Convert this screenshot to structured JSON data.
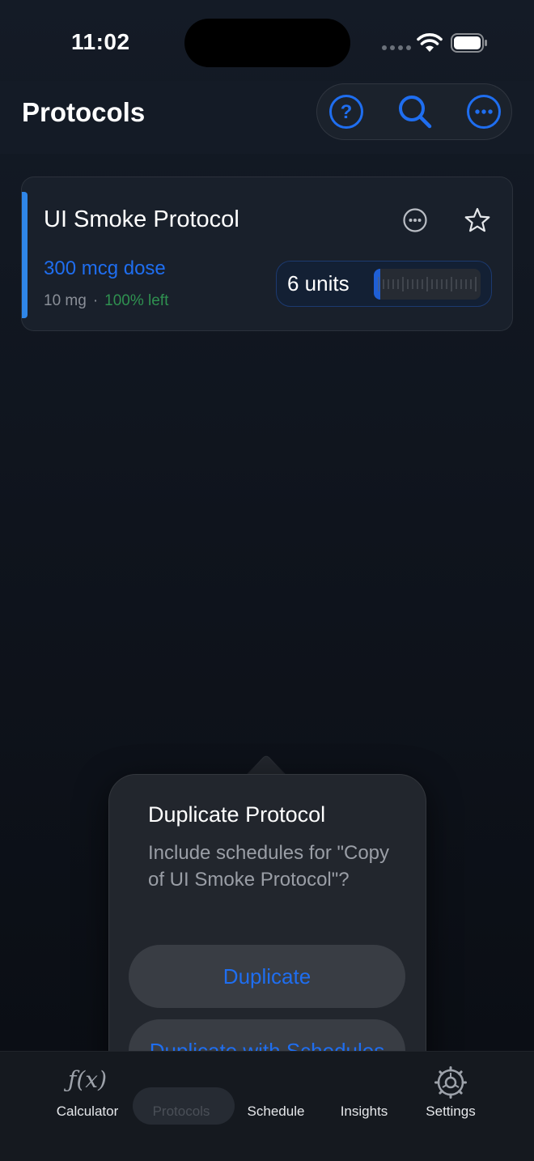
{
  "status_bar": {
    "time": "11:02"
  },
  "header": {
    "title": "Protocols",
    "actions": [
      "help-icon",
      "search-icon",
      "more-icon"
    ]
  },
  "protocol_card": {
    "name": "UI Smoke Protocol",
    "dose": "300 mcg dose",
    "amount": "10 mg",
    "separator": "·",
    "remaining": "100% left",
    "units": "6 units",
    "syringe_fill_fraction": 0.06,
    "accent_color": "#2f86e8"
  },
  "popover": {
    "title": "Duplicate Protocol",
    "message": "Include schedules for \"Copy of UI Smoke Protocol\"?",
    "buttons": {
      "duplicate": "Duplicate",
      "duplicate_with_schedules": "Duplicate with Schedules"
    }
  },
  "tab_bar": {
    "items": [
      {
        "label": "Calculator",
        "icon": "fx-icon"
      },
      {
        "label": "Protocols",
        "icon": "protocols-icon",
        "selected": true
      },
      {
        "label": "Schedule",
        "icon": "calendar-icon"
      },
      {
        "label": "Insights",
        "icon": "chart-icon"
      },
      {
        "label": "Settings",
        "icon": "gear-icon"
      }
    ]
  },
  "colors": {
    "accent": "#1f6ef0",
    "success": "#2f9150",
    "background": "#0f141d"
  }
}
